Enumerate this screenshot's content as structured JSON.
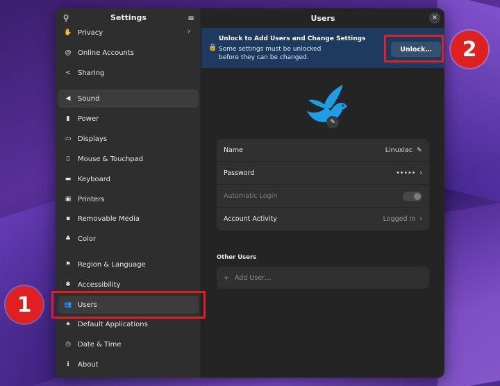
{
  "sidebar": {
    "title": "Settings",
    "items": [
      {
        "label": "Privacy",
        "icon": "hand-icon",
        "glyph": "✋",
        "chevron": "›"
      },
      {
        "label": "Online Accounts",
        "icon": "at-icon",
        "glyph": "@"
      },
      {
        "label": "Sharing",
        "icon": "share-icon",
        "glyph": "<"
      },
      {
        "label": "Sound",
        "icon": "speaker-icon",
        "glyph": "◀"
      },
      {
        "label": "Power",
        "icon": "battery-icon",
        "glyph": "▮"
      },
      {
        "label": "Displays",
        "icon": "display-icon",
        "glyph": "▭"
      },
      {
        "label": "Mouse & Touchpad",
        "icon": "mouse-icon",
        "glyph": "▯"
      },
      {
        "label": "Keyboard",
        "icon": "keyboard-icon",
        "glyph": "▬"
      },
      {
        "label": "Printers",
        "icon": "printer-icon",
        "glyph": "▣"
      },
      {
        "label": "Removable Media",
        "icon": "usb-icon",
        "glyph": "▪"
      },
      {
        "label": "Color",
        "icon": "color-icon",
        "glyph": "♣"
      },
      {
        "label": "Region & Language",
        "icon": "flag-icon",
        "glyph": "⚑"
      },
      {
        "label": "Accessibility",
        "icon": "accessibility-icon",
        "glyph": "✱"
      },
      {
        "label": "Users",
        "icon": "users-icon",
        "glyph": "👥"
      },
      {
        "label": "Default Applications",
        "icon": "star-icon",
        "glyph": "★"
      },
      {
        "label": "Date & Time",
        "icon": "clock-icon",
        "glyph": "◷"
      },
      {
        "label": "About",
        "icon": "info-icon",
        "glyph": "ℹ"
      }
    ],
    "active": "Users"
  },
  "header": {
    "title": "Users",
    "close_glyph": "✕",
    "search_glyph": "⚲",
    "menu_glyph": "≡"
  },
  "banner": {
    "title": "Unlock to Add Users and Change Settings",
    "subtitle_line1": "Some settings must be unlocked",
    "subtitle_line2": "before they can be changed.",
    "button": "Unlock…",
    "lock_glyph": "🔒"
  },
  "user": {
    "rows": [
      {
        "label": "Name",
        "value": "Linuxiac",
        "trail": "✎"
      },
      {
        "label": "Password",
        "value": "•••••",
        "trail": "›"
      },
      {
        "label": "Automatic Login",
        "value": "",
        "toggle": true,
        "enabled": false
      },
      {
        "label": "Account Activity",
        "value": "Logged in",
        "trail": "›"
      }
    ],
    "avatar_color": "#1e9ee8"
  },
  "other_users": {
    "title": "Other Users",
    "add_label": "Add User…",
    "add_glyph": "+"
  },
  "annotations": {
    "step1": "1",
    "step2": "2",
    "color": "#e02020"
  }
}
